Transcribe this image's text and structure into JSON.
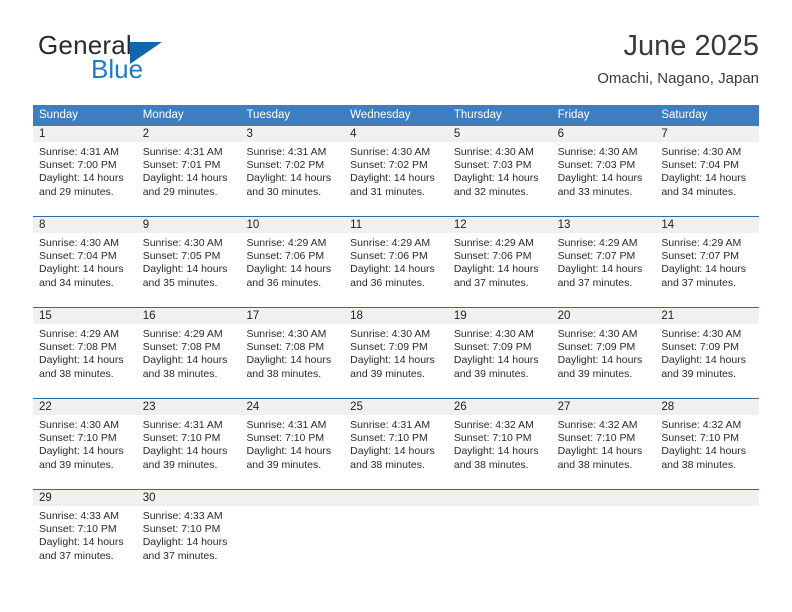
{
  "brand": {
    "name_part1": "General",
    "name_part2": "Blue",
    "triangle_color": "#1466a8",
    "blue_color": "#1e7bc4"
  },
  "header": {
    "month_title": "June 2025",
    "location": "Omachi, Nagano, Japan"
  },
  "theme": {
    "header_bar_color": "#3c7ebf",
    "row_divider_color": "#2e6da4",
    "day_band_color": "#f0f0f0",
    "text_color": "#222222"
  },
  "weekdays": [
    "Sunday",
    "Monday",
    "Tuesday",
    "Wednesday",
    "Thursday",
    "Friday",
    "Saturday"
  ],
  "weeks": [
    [
      {
        "day": "1",
        "sunrise": "Sunrise: 4:31 AM",
        "sunset": "Sunset: 7:00 PM",
        "daylight": "Daylight: 14 hours and 29 minutes."
      },
      {
        "day": "2",
        "sunrise": "Sunrise: 4:31 AM",
        "sunset": "Sunset: 7:01 PM",
        "daylight": "Daylight: 14 hours and 29 minutes."
      },
      {
        "day": "3",
        "sunrise": "Sunrise: 4:31 AM",
        "sunset": "Sunset: 7:02 PM",
        "daylight": "Daylight: 14 hours and 30 minutes."
      },
      {
        "day": "4",
        "sunrise": "Sunrise: 4:30 AM",
        "sunset": "Sunset: 7:02 PM",
        "daylight": "Daylight: 14 hours and 31 minutes."
      },
      {
        "day": "5",
        "sunrise": "Sunrise: 4:30 AM",
        "sunset": "Sunset: 7:03 PM",
        "daylight": "Daylight: 14 hours and 32 minutes."
      },
      {
        "day": "6",
        "sunrise": "Sunrise: 4:30 AM",
        "sunset": "Sunset: 7:03 PM",
        "daylight": "Daylight: 14 hours and 33 minutes."
      },
      {
        "day": "7",
        "sunrise": "Sunrise: 4:30 AM",
        "sunset": "Sunset: 7:04 PM",
        "daylight": "Daylight: 14 hours and 34 minutes."
      }
    ],
    [
      {
        "day": "8",
        "sunrise": "Sunrise: 4:30 AM",
        "sunset": "Sunset: 7:04 PM",
        "daylight": "Daylight: 14 hours and 34 minutes."
      },
      {
        "day": "9",
        "sunrise": "Sunrise: 4:30 AM",
        "sunset": "Sunset: 7:05 PM",
        "daylight": "Daylight: 14 hours and 35 minutes."
      },
      {
        "day": "10",
        "sunrise": "Sunrise: 4:29 AM",
        "sunset": "Sunset: 7:06 PM",
        "daylight": "Daylight: 14 hours and 36 minutes."
      },
      {
        "day": "11",
        "sunrise": "Sunrise: 4:29 AM",
        "sunset": "Sunset: 7:06 PM",
        "daylight": "Daylight: 14 hours and 36 minutes."
      },
      {
        "day": "12",
        "sunrise": "Sunrise: 4:29 AM",
        "sunset": "Sunset: 7:06 PM",
        "daylight": "Daylight: 14 hours and 37 minutes."
      },
      {
        "day": "13",
        "sunrise": "Sunrise: 4:29 AM",
        "sunset": "Sunset: 7:07 PM",
        "daylight": "Daylight: 14 hours and 37 minutes."
      },
      {
        "day": "14",
        "sunrise": "Sunrise: 4:29 AM",
        "sunset": "Sunset: 7:07 PM",
        "daylight": "Daylight: 14 hours and 37 minutes."
      }
    ],
    [
      {
        "day": "15",
        "sunrise": "Sunrise: 4:29 AM",
        "sunset": "Sunset: 7:08 PM",
        "daylight": "Daylight: 14 hours and 38 minutes."
      },
      {
        "day": "16",
        "sunrise": "Sunrise: 4:29 AM",
        "sunset": "Sunset: 7:08 PM",
        "daylight": "Daylight: 14 hours and 38 minutes."
      },
      {
        "day": "17",
        "sunrise": "Sunrise: 4:30 AM",
        "sunset": "Sunset: 7:08 PM",
        "daylight": "Daylight: 14 hours and 38 minutes."
      },
      {
        "day": "18",
        "sunrise": "Sunrise: 4:30 AM",
        "sunset": "Sunset: 7:09 PM",
        "daylight": "Daylight: 14 hours and 39 minutes."
      },
      {
        "day": "19",
        "sunrise": "Sunrise: 4:30 AM",
        "sunset": "Sunset: 7:09 PM",
        "daylight": "Daylight: 14 hours and 39 minutes."
      },
      {
        "day": "20",
        "sunrise": "Sunrise: 4:30 AM",
        "sunset": "Sunset: 7:09 PM",
        "daylight": "Daylight: 14 hours and 39 minutes."
      },
      {
        "day": "21",
        "sunrise": "Sunrise: 4:30 AM",
        "sunset": "Sunset: 7:09 PM",
        "daylight": "Daylight: 14 hours and 39 minutes."
      }
    ],
    [
      {
        "day": "22",
        "sunrise": "Sunrise: 4:30 AM",
        "sunset": "Sunset: 7:10 PM",
        "daylight": "Daylight: 14 hours and 39 minutes."
      },
      {
        "day": "23",
        "sunrise": "Sunrise: 4:31 AM",
        "sunset": "Sunset: 7:10 PM",
        "daylight": "Daylight: 14 hours and 39 minutes."
      },
      {
        "day": "24",
        "sunrise": "Sunrise: 4:31 AM",
        "sunset": "Sunset: 7:10 PM",
        "daylight": "Daylight: 14 hours and 39 minutes."
      },
      {
        "day": "25",
        "sunrise": "Sunrise: 4:31 AM",
        "sunset": "Sunset: 7:10 PM",
        "daylight": "Daylight: 14 hours and 38 minutes."
      },
      {
        "day": "26",
        "sunrise": "Sunrise: 4:32 AM",
        "sunset": "Sunset: 7:10 PM",
        "daylight": "Daylight: 14 hours and 38 minutes."
      },
      {
        "day": "27",
        "sunrise": "Sunrise: 4:32 AM",
        "sunset": "Sunset: 7:10 PM",
        "daylight": "Daylight: 14 hours and 38 minutes."
      },
      {
        "day": "28",
        "sunrise": "Sunrise: 4:32 AM",
        "sunset": "Sunset: 7:10 PM",
        "daylight": "Daylight: 14 hours and 38 minutes."
      }
    ],
    [
      {
        "day": "29",
        "sunrise": "Sunrise: 4:33 AM",
        "sunset": "Sunset: 7:10 PM",
        "daylight": "Daylight: 14 hours and 37 minutes."
      },
      {
        "day": "30",
        "sunrise": "Sunrise: 4:33 AM",
        "sunset": "Sunset: 7:10 PM",
        "daylight": "Daylight: 14 hours and 37 minutes."
      },
      {
        "day": "",
        "sunrise": "",
        "sunset": "",
        "daylight": ""
      },
      {
        "day": "",
        "sunrise": "",
        "sunset": "",
        "daylight": ""
      },
      {
        "day": "",
        "sunrise": "",
        "sunset": "",
        "daylight": ""
      },
      {
        "day": "",
        "sunrise": "",
        "sunset": "",
        "daylight": ""
      },
      {
        "day": "",
        "sunrise": "",
        "sunset": "",
        "daylight": ""
      }
    ]
  ]
}
